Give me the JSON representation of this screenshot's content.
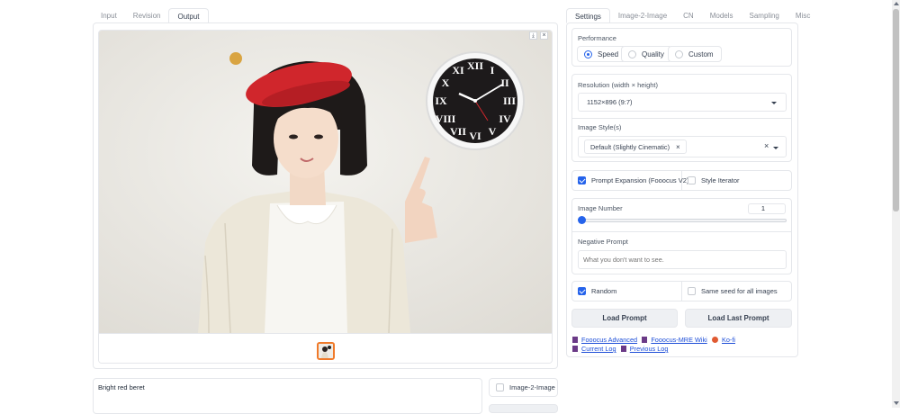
{
  "left_tabs": [
    "Input",
    "Revision",
    "Output"
  ],
  "left_active": "Output",
  "right_tabs": [
    "Settings",
    "Image-2-Image",
    "CN",
    "Models",
    "Sampling",
    "Misc"
  ],
  "right_active": "Settings",
  "image_controls": {
    "download": "⤓",
    "close": "×"
  },
  "prompt": {
    "value": "Bright red beret"
  },
  "image2image_checkbox": "Image-2-Image",
  "performance": {
    "label": "Performance",
    "options": [
      "Speed",
      "Quality",
      "Custom"
    ],
    "selected": "Speed"
  },
  "resolution": {
    "label": "Resolution (width × height)",
    "value": "1152×896 (9:7)"
  },
  "image_styles": {
    "label": "Image Style(s)",
    "tag": "Default (Slightly Cinematic)",
    "tag_close": "×",
    "clear": "×"
  },
  "prompt_expansion": {
    "label": "Prompt Expansion (Fooocus V2)",
    "checked": true
  },
  "style_iterator": {
    "label": "Style Iterator",
    "checked": false
  },
  "image_number": {
    "label": "Image Number",
    "value": "1",
    "slider_fraction": 0.0
  },
  "negative_prompt": {
    "label": "Negative Prompt",
    "placeholder": "What you don't want to see."
  },
  "random": {
    "label": "Random",
    "checked": true
  },
  "same_seed": {
    "label": "Same seed for all images",
    "checked": false
  },
  "buttons": {
    "load_prompt": "Load Prompt",
    "load_last_prompt": "Load Last Prompt"
  },
  "links": {
    "fooocus_advanced": "Fooocus Advanced",
    "mre_wiki": "Fooocus-MRE Wiki",
    "kofi": "Ko-fi",
    "current_log": "Current Log",
    "previous_log": "Previous Log"
  },
  "clock_numerals": [
    "XII",
    "I",
    "II",
    "III",
    "IV",
    "V",
    "VI",
    "VII",
    "VIII",
    "IX",
    "X",
    "XI"
  ],
  "colors": {
    "accent": "#2563eb",
    "beret": "#d0262c",
    "link": "#1d4ed8",
    "thumb_border": "#f07a2a"
  }
}
